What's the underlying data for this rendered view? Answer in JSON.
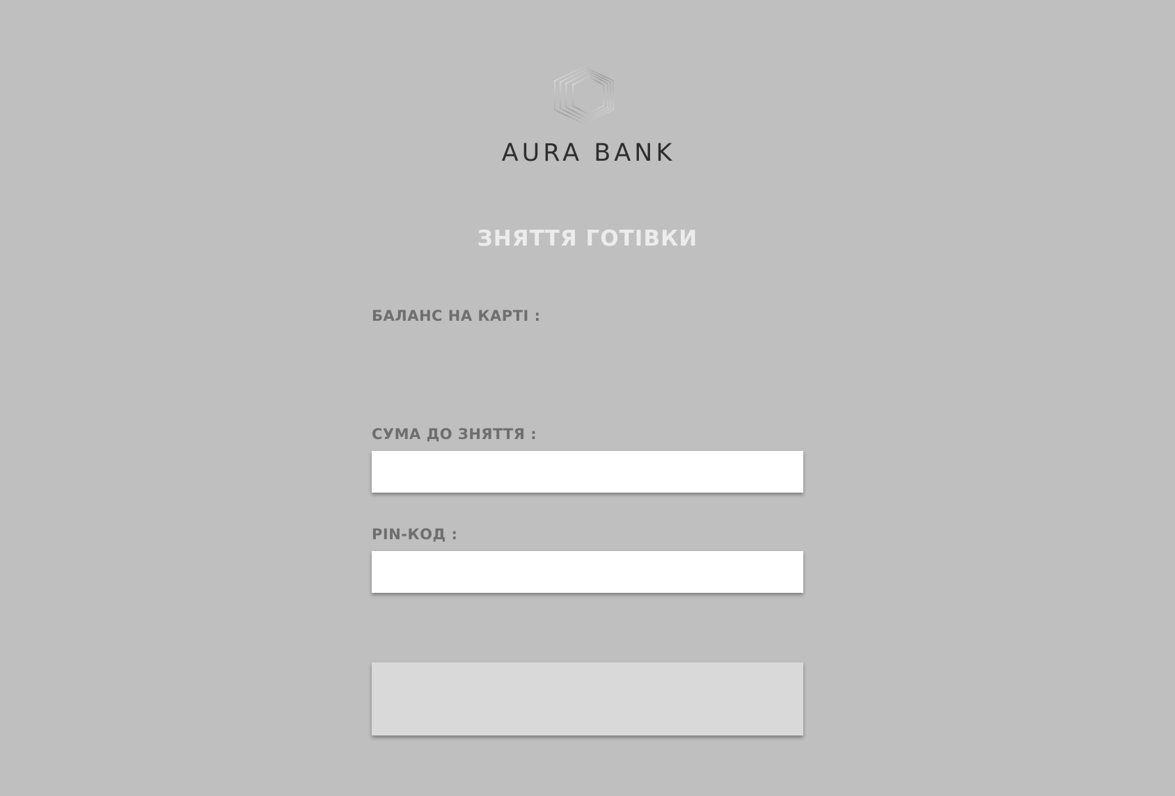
{
  "brand": {
    "name": "AURA BANK",
    "logo_icon": "hexagon-logo-icon"
  },
  "page": {
    "title": "ЗНЯТТЯ ГОТІВКИ"
  },
  "form": {
    "balance_label": "БАЛАНС НА КАРТІ :",
    "balance_value": "",
    "amount_label": "СУМА ДО ЗНЯТТЯ :",
    "amount_value": "",
    "amount_placeholder": "",
    "pin_label": "PIN-КОД :",
    "pin_value": "",
    "pin_placeholder": "",
    "submit_label": ""
  },
  "colors": {
    "background": "#bfbfbf",
    "brand_text": "#2e2e2e",
    "title_text": "#ececec",
    "label_text": "#6e6e6e",
    "input_background": "#ffffff",
    "button_background": "#d9d9d9"
  }
}
